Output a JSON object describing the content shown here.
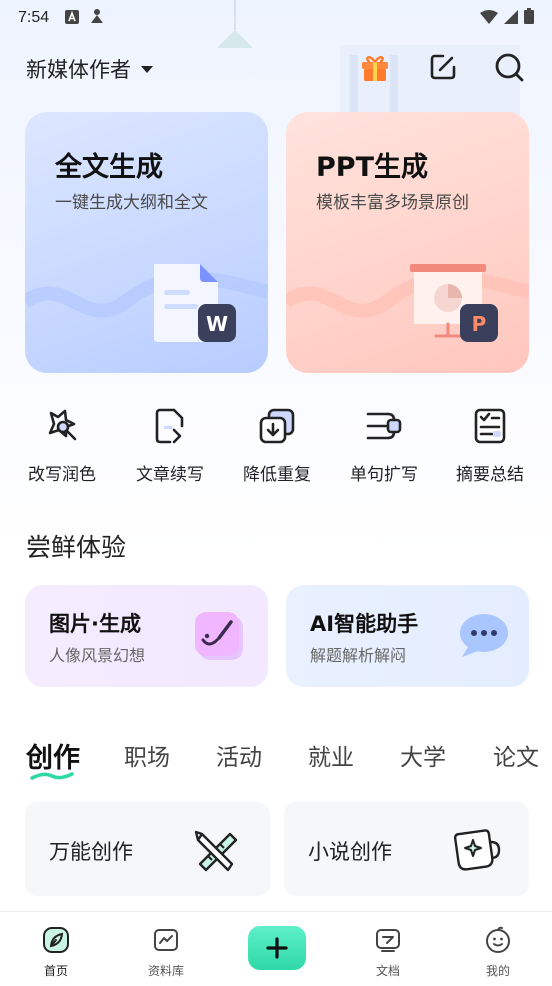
{
  "status_bar": {
    "time": "7:54"
  },
  "header": {
    "workspace": "新媒体作者"
  },
  "feature_cards": [
    {
      "title": "全文生成",
      "subtitle": "一键生成大纲和全文",
      "badge": "W"
    },
    {
      "title": "PPT生成",
      "subtitle": "模板丰富多场景原创",
      "badge": "P"
    }
  ],
  "tools": [
    {
      "label": "改写润色",
      "icon": "rewrite-icon"
    },
    {
      "label": "文章续写",
      "icon": "continue-icon"
    },
    {
      "label": "降低重复",
      "icon": "dedupe-icon"
    },
    {
      "label": "单句扩写",
      "icon": "expand-icon"
    },
    {
      "label": "摘要总结",
      "icon": "summary-icon"
    }
  ],
  "try_section": {
    "title": "尝鲜体验",
    "cards": [
      {
        "title": "图片·生成",
        "subtitle": "人像风景幻想",
        "icon": "paint-icon"
      },
      {
        "title": "AI智能助手",
        "subtitle": "解题解析解闷",
        "icon": "chat-bubble-icon"
      }
    ]
  },
  "category_tabs": [
    "创作",
    "职场",
    "活动",
    "就业",
    "大学",
    "论文"
  ],
  "active_tab": "创作",
  "creation_cards": [
    {
      "title": "万能创作",
      "icon": "ruler-pencil-icon"
    },
    {
      "title": "小说创作",
      "icon": "sparkle-cup-icon"
    }
  ],
  "bottom_nav": [
    {
      "label": "首页",
      "icon": "home-leaf-icon",
      "active": true
    },
    {
      "label": "资料库",
      "icon": "library-icon",
      "active": false
    },
    {
      "label": "",
      "icon": "plus-icon",
      "active": false
    },
    {
      "label": "文档",
      "icon": "document-icon",
      "active": false
    },
    {
      "label": "我的",
      "icon": "profile-icon",
      "active": false
    }
  ],
  "colors": {
    "accent_green": "#2fd9a6",
    "card_blue": "#c9d9ff",
    "card_pink": "#ffd4cc",
    "badge_dark": "#3a3f5c"
  }
}
